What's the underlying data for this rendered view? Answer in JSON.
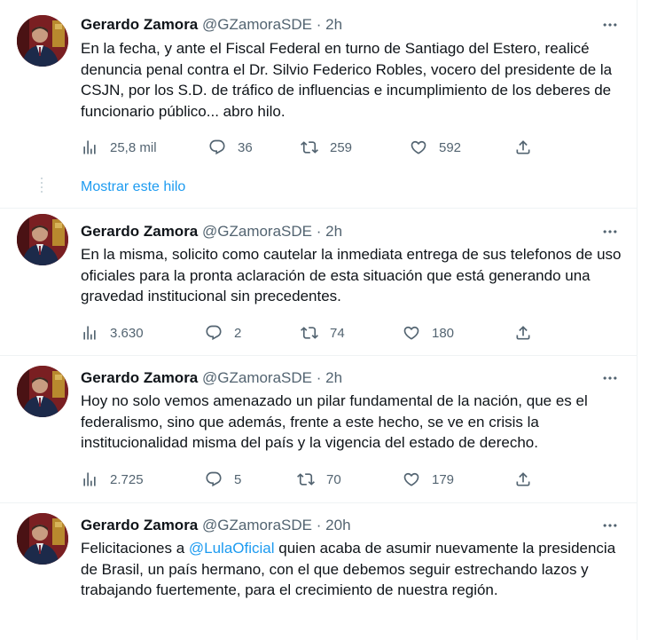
{
  "tweets": [
    {
      "name": "Gerardo Zamora",
      "handle": "@GZamoraSDE",
      "dot": "·",
      "time": "2h",
      "text": "En la fecha, y ante el Fiscal Federal en turno de Santiago del Estero, realicé denuncia penal contra el Dr. Silvio Federico Robles, vocero del presidente de la CSJN, por los S.D. de tráfico de influencias e incumplimiento de los deberes de funcionario público... abro hilo.",
      "views": "25,8 mil",
      "replies": "36",
      "retweets": "259",
      "likes": "592"
    },
    {
      "name": "Gerardo Zamora",
      "handle": "@GZamoraSDE",
      "dot": "·",
      "time": "2h",
      "text": "En la misma, solicito como cautelar la inmediata entrega de sus telefonos de uso oficiales para la pronta aclaración de esta situación que está generando una gravedad institucional sin precedentes.",
      "views": "3.630",
      "replies": "2",
      "retweets": "74",
      "likes": "180"
    },
    {
      "name": "Gerardo Zamora",
      "handle": "@GZamoraSDE",
      "dot": "·",
      "time": "2h",
      "text": "Hoy no solo vemos amenazado un pilar fundamental de la nación, que es el federalismo, sino que además, frente a este hecho, se ve en crisis la institucionalidad misma del país y la vigencia del estado de derecho.",
      "views": "2.725",
      "replies": "5",
      "retweets": "70",
      "likes": "179"
    },
    {
      "name": "Gerardo Zamora",
      "handle": "@GZamoraSDE",
      "dot": "·",
      "time": "20h",
      "text_before": "Felicitaciones a ",
      "mention": "@LulaOficial",
      "text_after": " quien acaba de asumir nuevamente la presidencia de Brasil, un país hermano, con el que debemos seguir estrechando lazos y trabajando fuertemente, para el crecimiento de nuestra región."
    }
  ],
  "show_thread_label": "Mostrar este hilo",
  "icons": {
    "views": "views-icon",
    "reply": "reply-icon",
    "retweet": "retweet-icon",
    "like": "like-icon",
    "share": "share-icon",
    "more": "more-icon"
  },
  "colors": {
    "text": "#0f1419",
    "secondary": "#536471",
    "accent": "#1d9bf0",
    "divider": "#eff3f4"
  }
}
